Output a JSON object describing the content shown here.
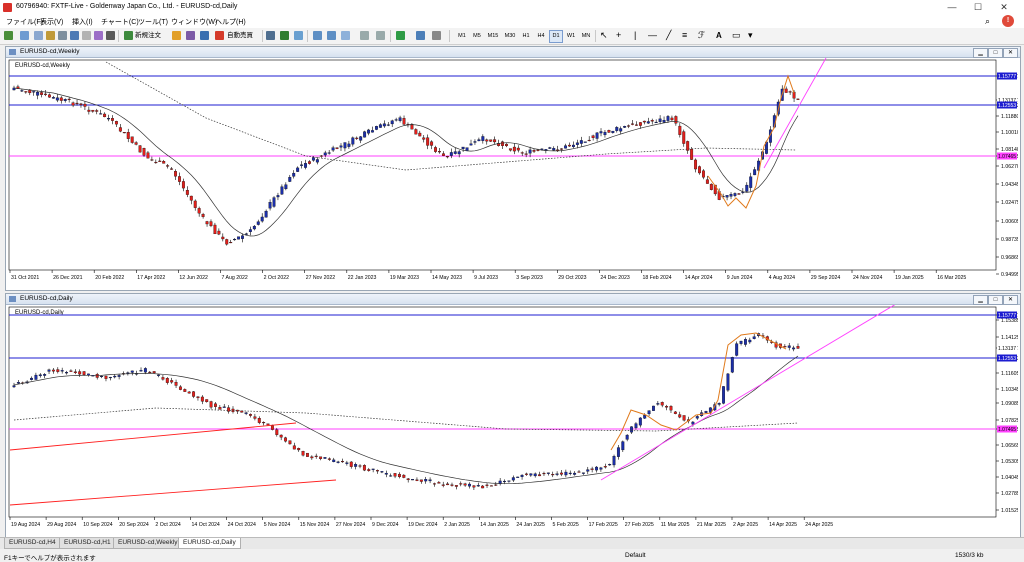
{
  "window": {
    "title": "60796940: FXTF-Live - Goldenway Japan Co., Ltd. - EURUSD-cd,Daily",
    "controls": [
      "—",
      "☐",
      "✕"
    ]
  },
  "menu": [
    "ファイル(F)",
    "表示(V)",
    "挿入(I)",
    "チャート(C)",
    "ツール(T)",
    "ウィンドウ(W)",
    "ヘルプ(H)"
  ],
  "toolbar": {
    "new_order": "新規注文",
    "auto_trade": "自動売買",
    "timeframes": [
      "M1",
      "M5",
      "M15",
      "M30",
      "H1",
      "H4",
      "D1",
      "W1",
      "MN"
    ],
    "selected_timeframe": "D1"
  },
  "colors": {
    "bull": "#1c2fa8",
    "bear": "#e0201c",
    "hline": "#1c1cd0",
    "magenta": "#ff40ff",
    "orange": "#e07a1c",
    "red_line": "#ff2020"
  },
  "charts": [
    {
      "window_title": "EURUSD-cd,Weekly",
      "label": "EURUSD-cd,Weekly",
      "price_ticks": [
        "1.15777",
        "1.13137",
        "1.12553",
        "1.11880",
        "1.10010",
        "1.08140",
        "1.07465",
        "1.06270",
        "1.04345",
        "1.02475",
        "1.00605",
        "0.98735",
        "0.96865",
        "0.94995"
      ],
      "date_ticks": [
        "31 Oct 2021",
        "26 Dec 2021",
        "20 Feb 2022",
        "17 Apr 2022",
        "12 Jun 2022",
        "7 Aug 2022",
        "2 Oct 2022",
        "27 Nov 2022",
        "22 Jan 2023",
        "19 Mar 2023",
        "14 May 2023",
        "9 Jul 2023",
        "3 Sep 2023",
        "29 Oct 2023",
        "24 Dec 2023",
        "18 Feb 2024",
        "14 Apr 2024",
        "9 Jun 2024",
        "4 Aug 2024",
        "29 Sep 2024",
        "24 Nov 2024",
        "19 Jan 2025",
        "16 Mar 2025"
      ],
      "last_price": "1.13137"
    },
    {
      "window_title": "EURUSD-cd,Daily",
      "label": "EURUSD-cd,Daily",
      "price_ticks": [
        "1.15777",
        "1.15385",
        "1.14125",
        "1.13137",
        "1.12553",
        "1.11605",
        "1.10345",
        "1.09085",
        "1.07825",
        "1.07465",
        "1.06565",
        "1.05305",
        "1.04045",
        "1.02785",
        "1.01525"
      ],
      "date_ticks": [
        "19 Aug 2024",
        "29 Aug 2024",
        "10 Sep 2024",
        "20 Sep 2024",
        "2 Oct 2024",
        "14 Oct 2024",
        "24 Oct 2024",
        "5 Nov 2024",
        "15 Nov 2024",
        "27 Nov 2024",
        "9 Dec 2024",
        "19 Dec 2024",
        "2 Jan 2025",
        "14 Jan 2025",
        "24 Jan 2025",
        "5 Feb 2025",
        "17 Feb 2025",
        "27 Feb 2025",
        "11 Mar 2025",
        "21 Mar 2025",
        "2 Apr 2025",
        "14 Apr 2025",
        "24 Apr 2025"
      ],
      "last_price": "1.13137"
    }
  ],
  "tabs": [
    "EURUSD-cd,H4",
    "EURUSD-cd,H1",
    "EURUSD-cd,Weekly",
    "EURUSD-cd,Daily"
  ],
  "active_tab": "EURUSD-cd,Daily",
  "status": {
    "help": "F1キーでヘルプが表示されます",
    "profile": "Default",
    "traffic": "1530/3 kb"
  }
}
